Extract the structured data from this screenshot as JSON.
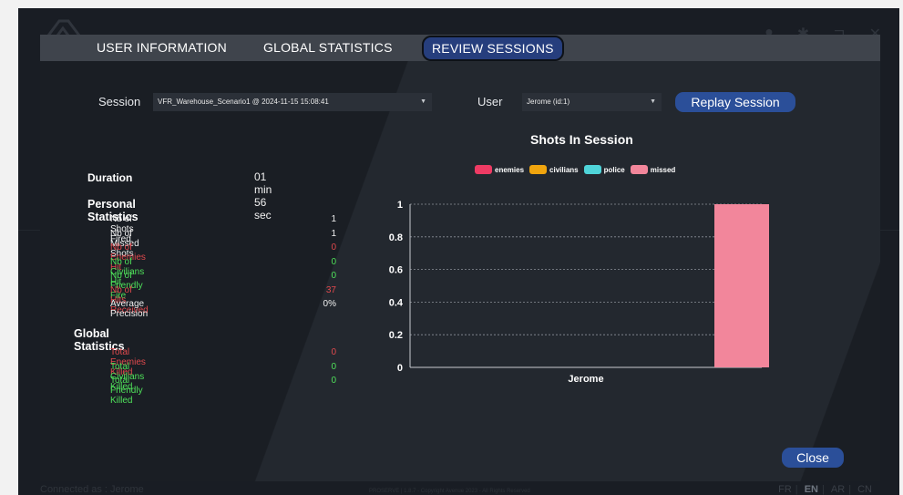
{
  "status": {
    "connected_as": "Connected as : Jerome",
    "footer": "PROSERVE | 1.8.7 - Copyright Avenue 2023 - All Rights Reserved"
  },
  "languages": [
    "FR",
    "EN",
    "AR",
    "CN"
  ],
  "tabs": [
    {
      "label": "USER INFORMATION",
      "active": false
    },
    {
      "label": "GLOBAL STATISTICS",
      "active": false
    },
    {
      "label": "REVIEW SESSIONS",
      "active": true
    }
  ],
  "session": {
    "session_label": "Session",
    "session_value": "VFR_Warehouse_Scenario1 @ 2024-11-15 15:08:41",
    "user_label": "User",
    "user_value": "Jerome (id:1)",
    "replay_label": "Replay Session"
  },
  "stats": {
    "duration_label": "Duration",
    "duration_value": "01 min 56 sec",
    "personal_title": "Personal Statistics",
    "personal": [
      {
        "label": "Nb of Shots Fired",
        "value": "1",
        "color": "#f0f0f0"
      },
      {
        "label": "Nb of Missed Shots",
        "value": "1",
        "color": "#f0f0f0"
      },
      {
        "label": "Nb of Enemies Hit",
        "value": "0",
        "color": "#e0494d"
      },
      {
        "label": "Nb of Civilians Hit",
        "value": "0",
        "color": "#4fe15a"
      },
      {
        "label": "Nb of Friendly Fire",
        "value": "0",
        "color": "#4fe15a"
      },
      {
        "label": "Nb of Hits Received",
        "value": "37",
        "color": "#e0494d"
      },
      {
        "label": "Average Precision",
        "value": "0%",
        "color": "#f0f0f0"
      }
    ],
    "global_title": "Global Statistics",
    "global": [
      {
        "label": "Total Enemies Killed",
        "value": "0",
        "color": "#e0494d"
      },
      {
        "label": "Total Civilians Killed",
        "value": "0",
        "color": "#4fe15a"
      },
      {
        "label": "Total Friendly Killed",
        "value": "0",
        "color": "#4fe15a"
      }
    ]
  },
  "close_label": "Close",
  "chart_data": {
    "type": "bar",
    "title": "Shots In Session",
    "categories": [
      "Jerome"
    ],
    "series": [
      {
        "name": "enemies",
        "values": [
          0
        ],
        "color": "#ee3b64"
      },
      {
        "name": "civilians",
        "values": [
          0
        ],
        "color": "#f0a50e"
      },
      {
        "name": "police",
        "values": [
          0
        ],
        "color": "#4fd4d9"
      },
      {
        "name": "missed",
        "values": [
          1
        ],
        "color": "#f2869b"
      }
    ],
    "ylim": [
      0,
      1
    ],
    "yticks": [
      "0",
      "0.2",
      "0.4",
      "0.6",
      "0.8",
      "1"
    ],
    "grid": true,
    "legend": "top"
  }
}
